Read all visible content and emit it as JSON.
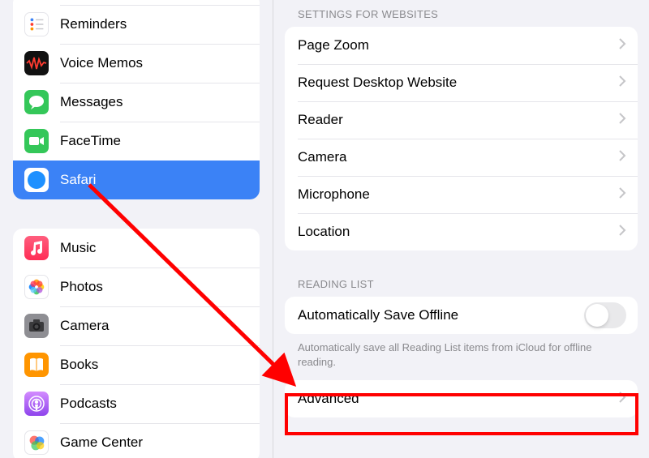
{
  "sidebar": {
    "group1": [
      {
        "label": "Reminders",
        "name": "sidebar-item-reminders",
        "icon": "reminders"
      },
      {
        "label": "Voice Memos",
        "name": "sidebar-item-voice-memos",
        "icon": "voice-memos"
      },
      {
        "label": "Messages",
        "name": "sidebar-item-messages",
        "icon": "messages"
      },
      {
        "label": "FaceTime",
        "name": "sidebar-item-facetime",
        "icon": "facetime"
      },
      {
        "label": "Safari",
        "name": "sidebar-item-safari",
        "icon": "safari",
        "selected": true
      }
    ],
    "group2": [
      {
        "label": "Music",
        "name": "sidebar-item-music",
        "icon": "music"
      },
      {
        "label": "Photos",
        "name": "sidebar-item-photos",
        "icon": "photos"
      },
      {
        "label": "Camera",
        "name": "sidebar-item-camera",
        "icon": "camera"
      },
      {
        "label": "Books",
        "name": "sidebar-item-books",
        "icon": "books"
      },
      {
        "label": "Podcasts",
        "name": "sidebar-item-podcasts",
        "icon": "podcasts"
      },
      {
        "label": "Game Center",
        "name": "sidebar-item-game-center",
        "icon": "game-center"
      }
    ]
  },
  "detail": {
    "websites_header": "SETTINGS FOR WEBSITES",
    "websites": [
      {
        "label": "Page Zoom",
        "name": "setting-page-zoom"
      },
      {
        "label": "Request Desktop Website",
        "name": "setting-request-desktop-website"
      },
      {
        "label": "Reader",
        "name": "setting-reader"
      },
      {
        "label": "Camera",
        "name": "setting-camera"
      },
      {
        "label": "Microphone",
        "name": "setting-microphone"
      },
      {
        "label": "Location",
        "name": "setting-location"
      }
    ],
    "reading_header": "READING LIST",
    "reading_row_label": "Automatically Save Offline",
    "reading_toggle_on": false,
    "reading_footer": "Automatically save all Reading List items from iCloud for offline reading.",
    "advanced_label": "Advanced"
  },
  "colors": {
    "selection": "#3b82f6",
    "annotation": "#ff0000"
  }
}
